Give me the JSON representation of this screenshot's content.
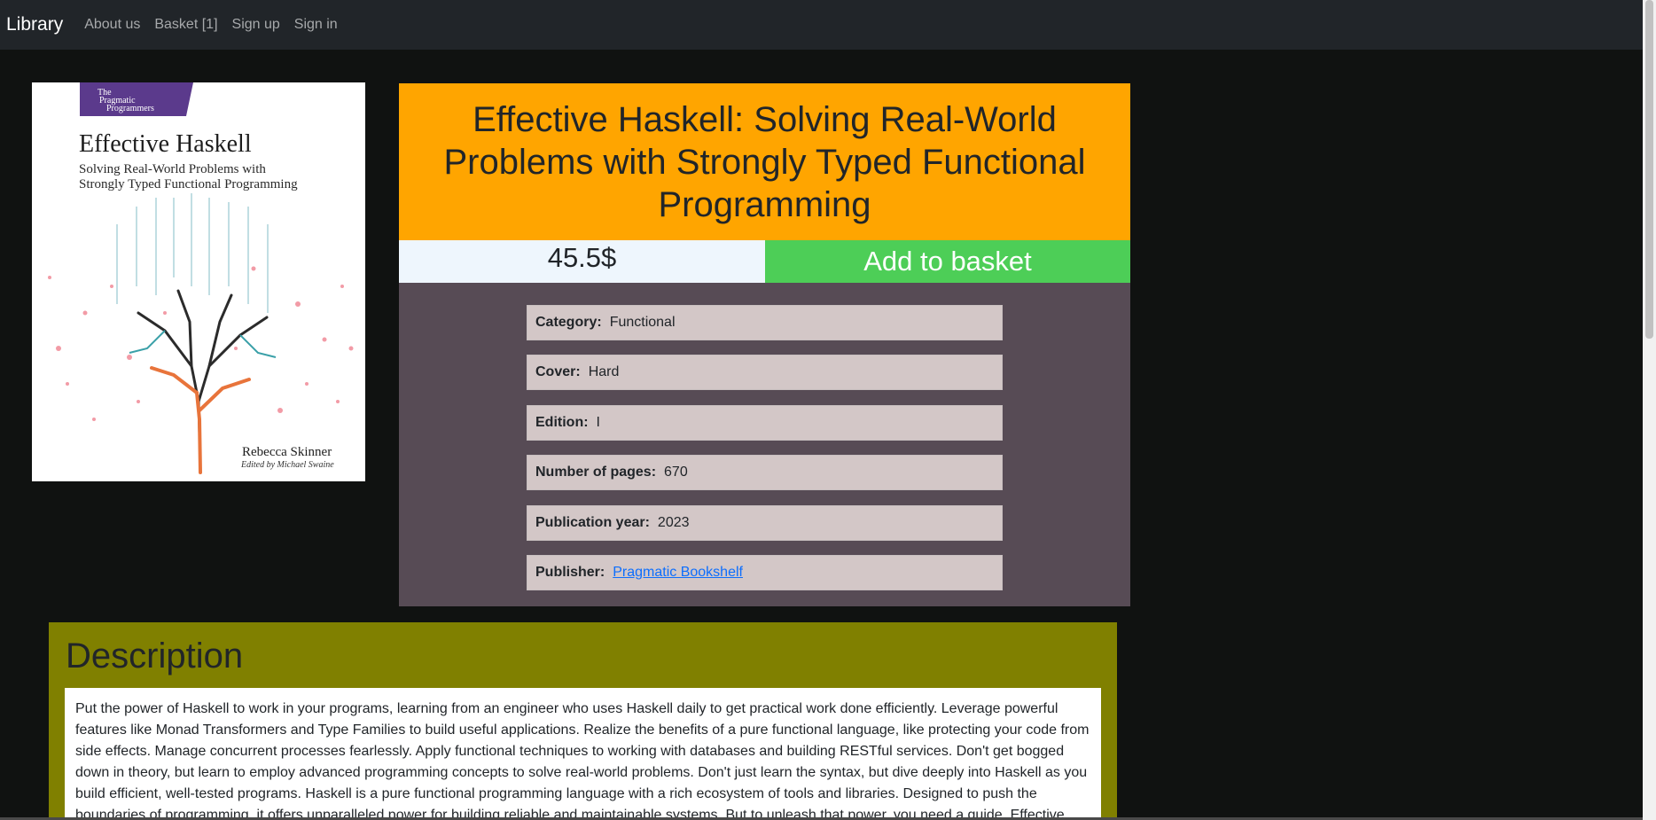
{
  "navbar": {
    "brand": "Library",
    "links": [
      "About us",
      "Basket [1]",
      "Sign up",
      "Sign in"
    ]
  },
  "cover": {
    "publisher_badge_line1": "The",
    "publisher_badge_line2": "Pragmatic",
    "publisher_badge_line3": "Programmers",
    "title": "Effective Haskell",
    "subtitle_line1": "Solving Real-World Problems with",
    "subtitle_line2": "Strongly Typed Functional Programming",
    "author": "Rebecca Skinner",
    "editor": "Edited by Michael Swaine",
    "badge_color": "#5b3a8c"
  },
  "book": {
    "title": "Effective Haskell: Solving Real-World Problems with Strongly Typed Functional Programming",
    "price": "45.5$",
    "add_button": "Add to basket"
  },
  "details": [
    {
      "label": "Category:",
      "value": "Functional"
    },
    {
      "label": "Cover:",
      "value": "Hard"
    },
    {
      "label": "Edition:",
      "value": "I"
    },
    {
      "label": "Number of pages:",
      "value": "670"
    },
    {
      "label": "Publication year:",
      "value": "2023"
    },
    {
      "label": "Publisher:",
      "value": "Pragmatic Bookshelf"
    }
  ],
  "description": {
    "heading": "Description",
    "text": "Put the power of Haskell to work in your programs, learning from an engineer who uses Haskell daily to get practical work done efficiently. Leverage powerful features like Monad Transformers and Type Families to build useful applications. Realize the benefits of a pure functional language, like protecting your code from side effects. Manage concurrent processes fearlessly. Apply functional techniques to working with databases and building RESTful services. Don't get bogged down in theory, but learn to employ advanced programming concepts to solve real-world problems. Don't just learn the syntax, but dive deeply into Haskell as you build efficient, well-tested programs. Haskell is a pure functional programming language with a rich ecosystem of tools and libraries. Designed to push the boundaries of programming, it offers unparalleled power for building reliable and maintainable systems. But to unleash that power, you need a guide. Effective"
  },
  "colors": {
    "title_bg": "#ffa500",
    "button_bg": "#4dce57",
    "details_bg": "#574b55",
    "description_bg": "#808000"
  }
}
